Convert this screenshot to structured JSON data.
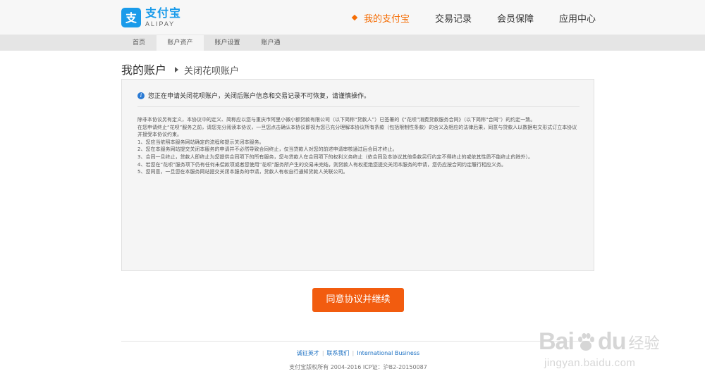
{
  "logo": {
    "cn": "支付宝",
    "en": "ALIPAY",
    "icon": "alipay-logo-icon",
    "brand_color": "#1a9bea"
  },
  "main_nav": [
    {
      "label": "我的支付宝",
      "active": true
    },
    {
      "label": "交易记录",
      "active": false
    },
    {
      "label": "会员保障",
      "active": false
    },
    {
      "label": "应用中心",
      "active": false
    }
  ],
  "sub_nav": [
    {
      "label": "首页",
      "active": false
    },
    {
      "label": "账户资产",
      "active": true
    },
    {
      "label": "账户设置",
      "active": false
    },
    {
      "label": "账户通",
      "active": false
    }
  ],
  "breadcrumb": {
    "title": "我的账户",
    "sub": "关闭花呗账户"
  },
  "notice": "您正在申请关闭花呗账户，关闭后账户信息和交易记录不可恢复，请谨慎操作。",
  "terms": [
    "除非本协议另有定义，本协议中的定义、简称应以您与重庆市阿里小微小额贷款有限公司（以下简称“贷款人”）已签署的《“花呗”消费贷款服务合同》（以下简称“合同”）的约定一致。",
    "在您申请终止“花呗”服务之前，请您充分阅读本协议，一旦您点击确认本协议即视为您已充分理解本协议所有条款（包括限制性条款）的含义及相应的法律后果，同意与贷款人以数据电文形式订立本协议并接受本协议约束。",
    "1、您应当依照本服务网站确定的流程和提示关闭本服务。",
    "2、您在本服务网站提交关闭本服务的申请并不必然导致合同终止，仅当贷款人对您的前述申请审核通过后合同才终止。",
    "3、合同一旦终止，贷款人即终止为您提供合同项下的所有服务，您与贷款人在合同项下的权利义务终止（依合同及本协议其他条款另行约定不得终止的或依其性质不能终止的除外）。",
    "4、若您在“花呗”服务项下仍有任何未偿款项或者您使用“花呗”服务所产生的交易未完结，则贷款人有权拒绝您提交关闭本服务的申请，您仍应按合同约定履行相应义务。",
    "5、您同意，一旦您在本服务网站提交关闭本服务的申请，贷款人有权自行通知贷款人关联公司。"
  ],
  "agree_button": "同意协议并继续",
  "accent_color": "#f25c0f",
  "footer": {
    "links": [
      "诚征英才",
      "联系我们",
      "International Business"
    ],
    "copyright": "支付宝版权所有 2004-2016 ICP证：沪B2-20150087"
  },
  "watermark": {
    "brand": "Bai",
    "brand2": "du",
    "cn": "经验",
    "url": "jingyan.baidu.com"
  }
}
